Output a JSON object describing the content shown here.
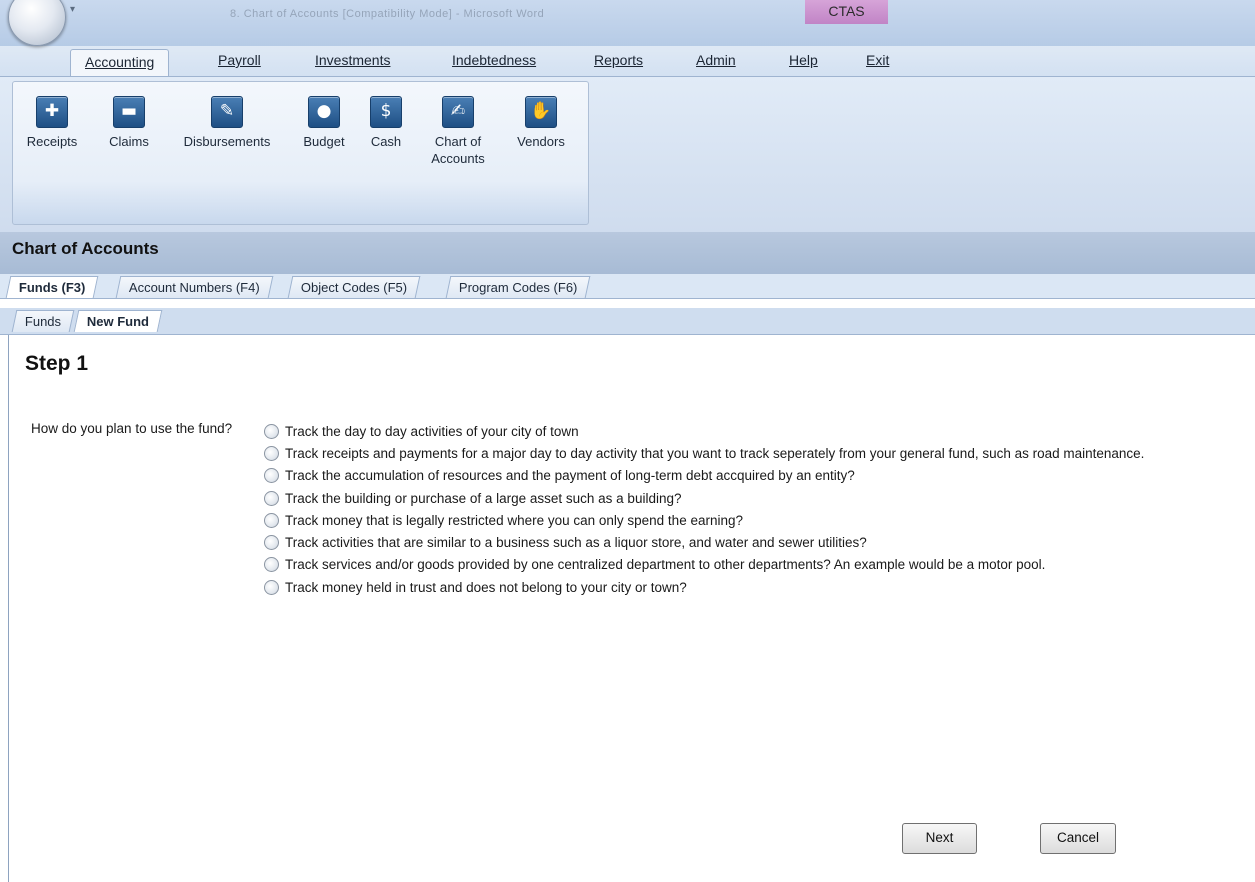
{
  "window": {
    "title_blurred": "8. Chart of Accounts [Compatibility Mode] - Microsoft Word",
    "app_tag": "CTAS",
    "quick_access": "▾"
  },
  "menu": {
    "items": [
      {
        "label": "Accounting"
      },
      {
        "label": "Payroll"
      },
      {
        "label": "Investments"
      },
      {
        "label": "Indebtedness"
      },
      {
        "label": "Reports"
      },
      {
        "label": "Admin"
      },
      {
        "label": "Help"
      },
      {
        "label": "Exit"
      }
    ]
  },
  "ribbon": {
    "buttons": [
      {
        "label": "Receipts",
        "icon": "receipts-icon",
        "glyph": "✚"
      },
      {
        "label": "Claims",
        "icon": "claims-icon",
        "glyph": "▬"
      },
      {
        "label": "Disbursements",
        "icon": "disbursements-icon",
        "glyph": "✎"
      },
      {
        "label": "Budget",
        "icon": "piggy-bank-icon",
        "glyph": "●"
      },
      {
        "label": "Cash",
        "icon": "cash-icon",
        "glyph": "$"
      },
      {
        "label": "Chart of Accounts",
        "label_line1": "Chart of",
        "label_line2": "Accounts",
        "icon": "chart-of-accounts-icon",
        "glyph": "✍"
      },
      {
        "label": "Vendors",
        "icon": "handshake-icon",
        "glyph": "✋"
      }
    ]
  },
  "section": {
    "title": "Chart of Accounts"
  },
  "tabs_primary": [
    {
      "label": "Funds (F3)"
    },
    {
      "label": "Account Numbers (F4)"
    },
    {
      "label": "Object Codes (F5)"
    },
    {
      "label": "Program Codes (F6)"
    }
  ],
  "tabs_secondary": [
    {
      "label": "Funds"
    },
    {
      "label": "New Fund"
    }
  ],
  "form": {
    "step_title": "Step 1",
    "question": "How do you plan to use the fund?",
    "options": [
      "Track the day to day activities of your city of town",
      "Track receipts and payments for a major day to day activity that you want to track seperately from your general fund, such as road maintenance.",
      "Track the accumulation of resources and the payment of long-term debt accquired by an entity?",
      "Track the building or purchase of a large asset such as a building?",
      "Track money that is legally restricted where you can only spend the earning?",
      "Track activities that are similar to a business such as a liquor store, and water and sewer utilities?",
      "Track services and/or goods provided by one centralized department to other departments? An example would be a motor pool.",
      "Track money held in trust and does not belong to your city or town?"
    ],
    "next_label": "Next",
    "cancel_label": "Cancel"
  }
}
